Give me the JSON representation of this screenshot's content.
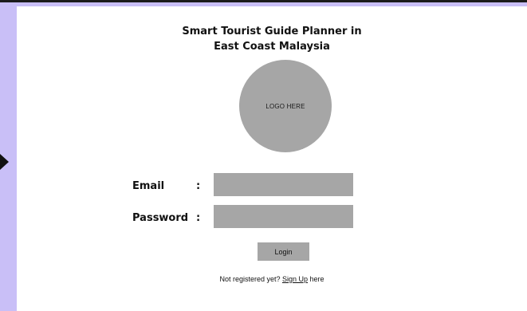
{
  "app": {
    "title_line1": "Smart Tourist Guide Planner in",
    "title_line2": "East Coast Malaysia"
  },
  "logo": {
    "text": "LOGO HERE",
    "color": "#a6a6a6"
  },
  "form": {
    "email_label": "Email",
    "password_label": "Password",
    "colon": ":",
    "email_value": "",
    "password_value": ""
  },
  "actions": {
    "login_label": "Login"
  },
  "register": {
    "prefix": "Not registered yet? ",
    "link_label": "Sign Up",
    "suffix": " here"
  },
  "colors": {
    "background": "#c9bff7",
    "card": "#ffffff",
    "field": "#a6a6a6",
    "text": "#111111"
  },
  "icons": {
    "side_arrow": "arrow-right-icon"
  }
}
